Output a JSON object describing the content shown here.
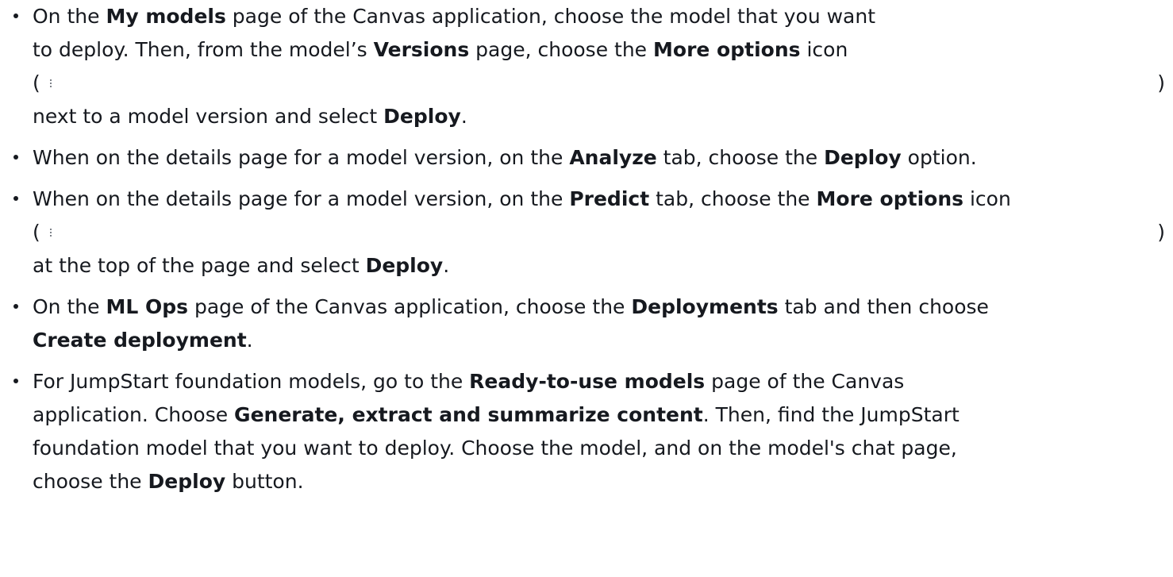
{
  "items": [
    {
      "line1_a": "On the ",
      "line1_b": "My models",
      "line1_c": " page of the Canvas application, choose the model that you want",
      "line2_a": "to deploy. Then, from the model’s ",
      "line2_b": "Versions",
      "line2_c": " page, choose the ",
      "line2_d": "More options",
      "line2_e": " icon",
      "paren_open": "(",
      "paren_close": ")",
      "line4_a": "next to a model version and select ",
      "line4_b": "Deploy",
      "line4_c": "."
    },
    {
      "a": "When on the details page for a model version, on the ",
      "b": "Analyze",
      "c": " tab, choose the ",
      "d": "Deploy",
      "e": " option."
    },
    {
      "line1_a": "When on the details page for a model version, on the ",
      "line1_b": "Predict",
      "line1_c": " tab, choose the ",
      "line1_d": "More options",
      "line1_e": " icon",
      "paren_open": "(",
      "paren_close": ")",
      "line3_a": "at the top of the page and select ",
      "line3_b": "Deploy",
      "line3_c": "."
    },
    {
      "line1_a": "On the ",
      "line1_b": "ML Ops",
      "line1_c": " page of the Canvas application, choose the ",
      "line1_d": "Deployments",
      "line1_e": " tab and then choose",
      "line2_a": "Create deployment",
      "line2_b": "."
    },
    {
      "line1_a": "For JumpStart foundation models, go to the ",
      "line1_b": "Ready-to-use models",
      "line1_c": " page of the Canvas",
      "line2_a": "application. Choose ",
      "line2_b": "Generate, extract and summarize content",
      "line2_c": ". Then, find the JumpStart",
      "line3": "foundation model that you want to deploy. Choose the model, and on the model's chat page,",
      "line4_a": "choose the ",
      "line4_b": "Deploy",
      "line4_c": " button."
    }
  ],
  "icons": {
    "more_options": "more-options-vertical-dots-icon"
  }
}
